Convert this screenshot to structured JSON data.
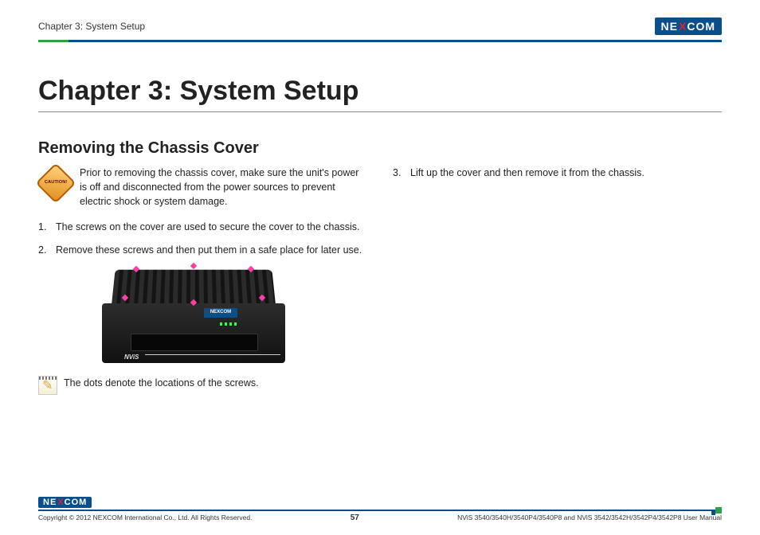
{
  "header": {
    "chapter_tag": "Chapter 3: System Setup",
    "logo_left": "NE",
    "logo_x": "X",
    "logo_right": "COM"
  },
  "title": "Chapter 3: System Setup",
  "section_title": "Removing the Chassis Cover",
  "caution": {
    "label": "CAUTION!",
    "text": "Prior to removing the chassis cover, make sure the unit's power is off and disconnected from the power sources to prevent electric shock or system damage."
  },
  "steps_left": [
    {
      "num": "1.",
      "text": "The screws on the cover are used to secure the cover to the chassis."
    },
    {
      "num": "2.",
      "text": "Remove these screws and then put them in a safe place for later use."
    }
  ],
  "steps_right": [
    {
      "num": "3.",
      "text": "Lift up the cover and then remove it from the chassis."
    }
  ],
  "device": {
    "brand": "NEXCOM",
    "model": "NViS"
  },
  "note": "The dots denote the locations of the screws.",
  "footer": {
    "copyright": "Copyright © 2012 NEXCOM International Co., Ltd. All Rights Reserved.",
    "page": "57",
    "manual": "NViS 3540/3540H/3540P4/3540P8 and NViS 3542/3542H/3542P4/3542P8 User Manual"
  }
}
